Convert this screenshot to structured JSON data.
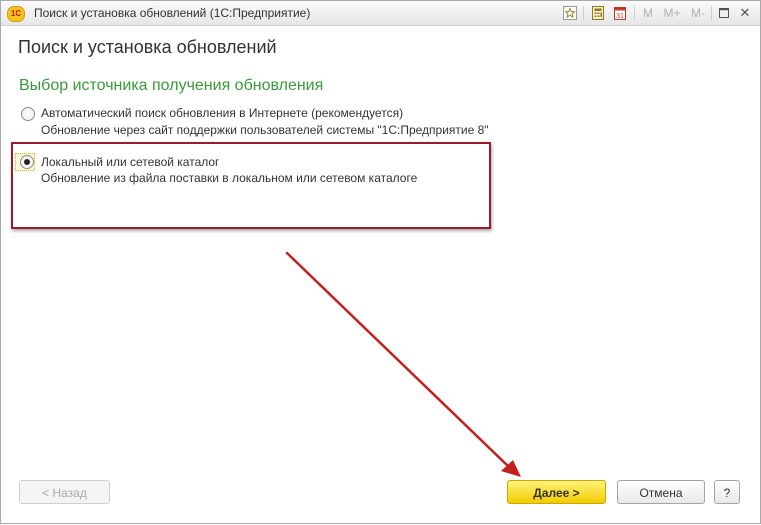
{
  "window": {
    "title": "Поиск и установка обновлений  (1С:Предприятие)",
    "app_icon_text": "1С",
    "toolbar": {
      "favorite_icon": "star-icon",
      "calc_icon": "calculator-icon",
      "calendar_icon": "calendar-icon",
      "calendar_day": "31",
      "m_label": "M",
      "m_plus_label": "M+",
      "m_minus_label": "M-",
      "maximize_icon": "maximize-icon",
      "close_label": "✕"
    }
  },
  "page": {
    "heading": "Поиск и установка обновлений",
    "section_title": "Выбор источника получения обновления"
  },
  "options": [
    {
      "label": "Автоматический поиск обновления в Интернете (рекомендуется)",
      "description": "Обновление через сайт поддержки пользователей системы \"1С:Предприятие 8\"",
      "selected": false
    },
    {
      "label": "Локальный или сетевой каталог",
      "description": "Обновление из файла поставки в локальном или сетевом каталоге",
      "selected": true
    }
  ],
  "buttons": {
    "back": "< Назад",
    "next": "Далее >",
    "cancel": "Отмена",
    "help": "?"
  },
  "colors": {
    "section_title": "#3a9a3a",
    "annotation": "#9a1c2a",
    "primary_button": "#f1cc00"
  }
}
